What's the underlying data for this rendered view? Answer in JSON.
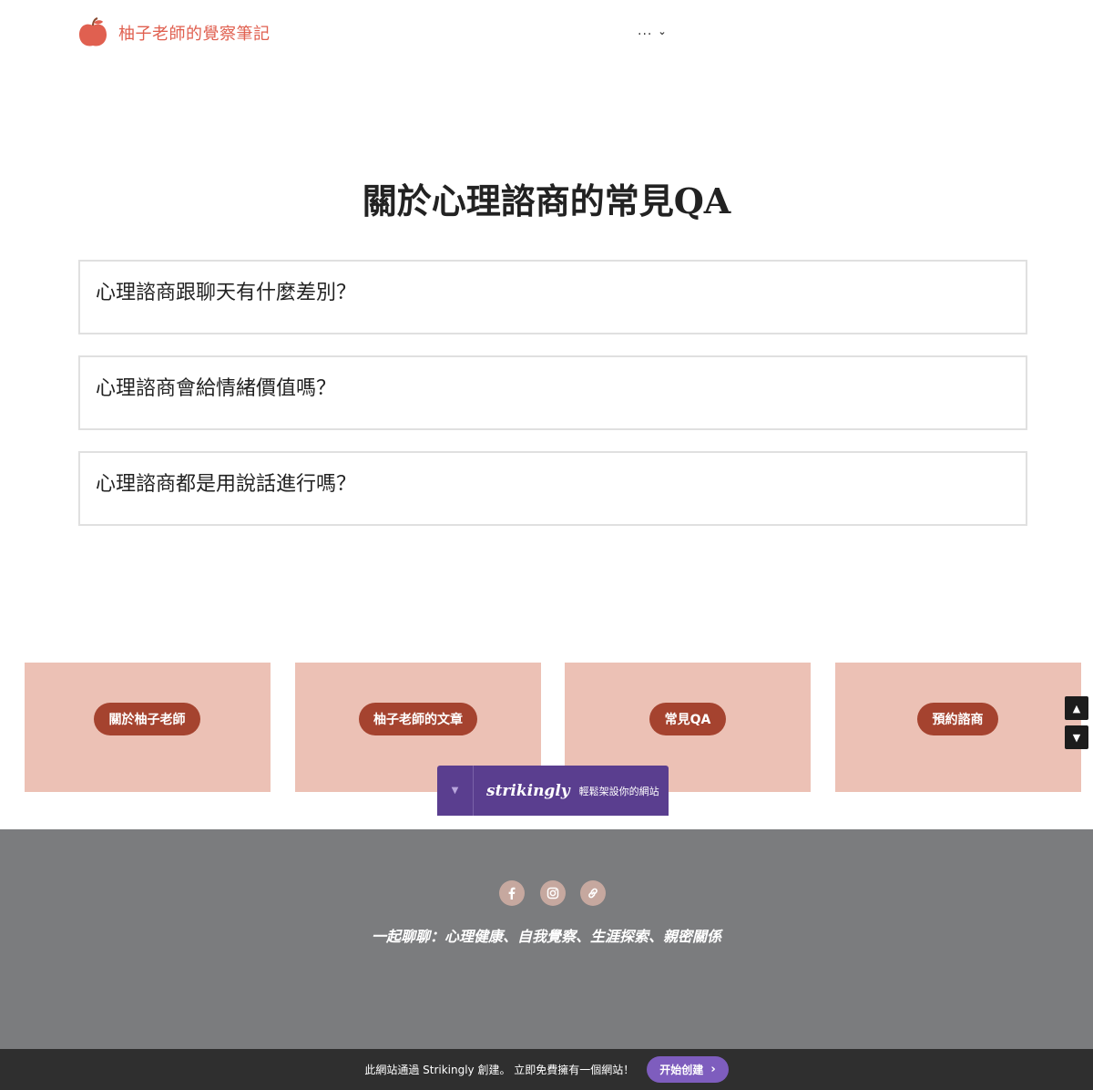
{
  "header": {
    "logo_text": "柚子老師的覺察筆記",
    "nav_more_label": "...",
    "nav_more_icon": "chevron-down-icon"
  },
  "main": {
    "title": "關於心理諮商的常見QA",
    "faq": [
      {
        "question": "心理諮商跟聊天有什麼差別？"
      },
      {
        "question": "心理諮商會給情緒價值嗎？"
      },
      {
        "question": "心理諮商都是用說話進行嗎？"
      }
    ]
  },
  "tiles": [
    {
      "label": "關於柚子老師"
    },
    {
      "label": "柚子老師的文章"
    },
    {
      "label": "常見QA"
    },
    {
      "label": "預約諮商"
    }
  ],
  "badge": {
    "brand": "strikingly",
    "tagline": "輕鬆架設你的網站"
  },
  "footer": {
    "social": [
      "facebook-icon",
      "instagram-icon",
      "link-icon"
    ],
    "tagline": "一起聊聊：心理健康、自我覺察、生涯探索、親密關係"
  },
  "bottom_bar": {
    "text": "此網站通過 Strikingly 創建。 立即免費擁有一個網站！",
    "cta_label": "开始创建"
  },
  "colors": {
    "accent": "#e06050",
    "tile_bg": "#ecc1b5",
    "tile_button": "#a5432f",
    "footer_bg": "#7b7c7e",
    "badge_bg": "#5a3e8f",
    "cta_bg": "#7e5dbe"
  }
}
